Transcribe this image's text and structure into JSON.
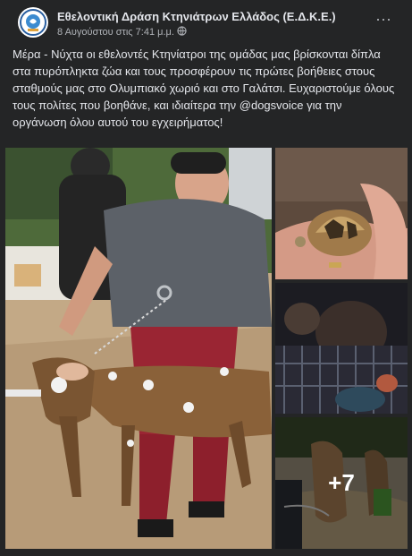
{
  "post": {
    "author": "Εθελοντική Δράση Κτηνιάτρων Ελλάδος (Ε.Δ.Κ.Ε.)",
    "timestamp": "8 Αυγούστου στις 7:41 μ.μ.",
    "privacy_icon": "globe-icon",
    "more_icon": "ellipsis-icon",
    "more_label": "···",
    "text": "Μέρα - Νύχτα οι εθελοντές Κτηνίατροι της ομάδας μας βρίσκονται δίπλα στα πυρόπληκτα ζώα και τους προσφέρουν τις πρώτες βοήθειες στους σταθμούς μας στο Ολυμπιακό χωριό και στο Γαλάτσι. Ευχαριστούμε όλους τους πολίτες που βοηθάνε, και ιδιαίτερα την @dogsvoice για την οργάνωση όλου αυτού του εγχειρήματος!"
  },
  "photos": {
    "extra_count_label": "+7",
    "accent": "#b2593f"
  }
}
